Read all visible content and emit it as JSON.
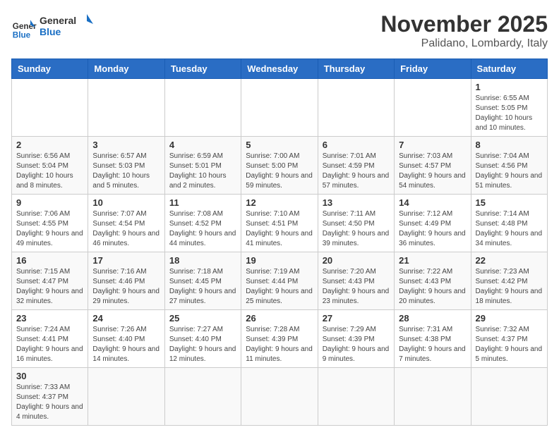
{
  "header": {
    "logo_general": "General",
    "logo_blue": "Blue",
    "month_title": "November 2025",
    "location": "Palidano, Lombardy, Italy"
  },
  "days_of_week": [
    "Sunday",
    "Monday",
    "Tuesday",
    "Wednesday",
    "Thursday",
    "Friday",
    "Saturday"
  ],
  "weeks": [
    [
      {
        "day": "",
        "info": ""
      },
      {
        "day": "",
        "info": ""
      },
      {
        "day": "",
        "info": ""
      },
      {
        "day": "",
        "info": ""
      },
      {
        "day": "",
        "info": ""
      },
      {
        "day": "",
        "info": ""
      },
      {
        "day": "1",
        "info": "Sunrise: 6:55 AM\nSunset: 5:05 PM\nDaylight: 10 hours and 10 minutes."
      }
    ],
    [
      {
        "day": "2",
        "info": "Sunrise: 6:56 AM\nSunset: 5:04 PM\nDaylight: 10 hours and 8 minutes."
      },
      {
        "day": "3",
        "info": "Sunrise: 6:57 AM\nSunset: 5:03 PM\nDaylight: 10 hours and 5 minutes."
      },
      {
        "day": "4",
        "info": "Sunrise: 6:59 AM\nSunset: 5:01 PM\nDaylight: 10 hours and 2 minutes."
      },
      {
        "day": "5",
        "info": "Sunrise: 7:00 AM\nSunset: 5:00 PM\nDaylight: 9 hours and 59 minutes."
      },
      {
        "day": "6",
        "info": "Sunrise: 7:01 AM\nSunset: 4:59 PM\nDaylight: 9 hours and 57 minutes."
      },
      {
        "day": "7",
        "info": "Sunrise: 7:03 AM\nSunset: 4:57 PM\nDaylight: 9 hours and 54 minutes."
      },
      {
        "day": "8",
        "info": "Sunrise: 7:04 AM\nSunset: 4:56 PM\nDaylight: 9 hours and 51 minutes."
      }
    ],
    [
      {
        "day": "9",
        "info": "Sunrise: 7:06 AM\nSunset: 4:55 PM\nDaylight: 9 hours and 49 minutes."
      },
      {
        "day": "10",
        "info": "Sunrise: 7:07 AM\nSunset: 4:54 PM\nDaylight: 9 hours and 46 minutes."
      },
      {
        "day": "11",
        "info": "Sunrise: 7:08 AM\nSunset: 4:52 PM\nDaylight: 9 hours and 44 minutes."
      },
      {
        "day": "12",
        "info": "Sunrise: 7:10 AM\nSunset: 4:51 PM\nDaylight: 9 hours and 41 minutes."
      },
      {
        "day": "13",
        "info": "Sunrise: 7:11 AM\nSunset: 4:50 PM\nDaylight: 9 hours and 39 minutes."
      },
      {
        "day": "14",
        "info": "Sunrise: 7:12 AM\nSunset: 4:49 PM\nDaylight: 9 hours and 36 minutes."
      },
      {
        "day": "15",
        "info": "Sunrise: 7:14 AM\nSunset: 4:48 PM\nDaylight: 9 hours and 34 minutes."
      }
    ],
    [
      {
        "day": "16",
        "info": "Sunrise: 7:15 AM\nSunset: 4:47 PM\nDaylight: 9 hours and 32 minutes."
      },
      {
        "day": "17",
        "info": "Sunrise: 7:16 AM\nSunset: 4:46 PM\nDaylight: 9 hours and 29 minutes."
      },
      {
        "day": "18",
        "info": "Sunrise: 7:18 AM\nSunset: 4:45 PM\nDaylight: 9 hours and 27 minutes."
      },
      {
        "day": "19",
        "info": "Sunrise: 7:19 AM\nSunset: 4:44 PM\nDaylight: 9 hours and 25 minutes."
      },
      {
        "day": "20",
        "info": "Sunrise: 7:20 AM\nSunset: 4:43 PM\nDaylight: 9 hours and 23 minutes."
      },
      {
        "day": "21",
        "info": "Sunrise: 7:22 AM\nSunset: 4:43 PM\nDaylight: 9 hours and 20 minutes."
      },
      {
        "day": "22",
        "info": "Sunrise: 7:23 AM\nSunset: 4:42 PM\nDaylight: 9 hours and 18 minutes."
      }
    ],
    [
      {
        "day": "23",
        "info": "Sunrise: 7:24 AM\nSunset: 4:41 PM\nDaylight: 9 hours and 16 minutes."
      },
      {
        "day": "24",
        "info": "Sunrise: 7:26 AM\nSunset: 4:40 PM\nDaylight: 9 hours and 14 minutes."
      },
      {
        "day": "25",
        "info": "Sunrise: 7:27 AM\nSunset: 4:40 PM\nDaylight: 9 hours and 12 minutes."
      },
      {
        "day": "26",
        "info": "Sunrise: 7:28 AM\nSunset: 4:39 PM\nDaylight: 9 hours and 11 minutes."
      },
      {
        "day": "27",
        "info": "Sunrise: 7:29 AM\nSunset: 4:39 PM\nDaylight: 9 hours and 9 minutes."
      },
      {
        "day": "28",
        "info": "Sunrise: 7:31 AM\nSunset: 4:38 PM\nDaylight: 9 hours and 7 minutes."
      },
      {
        "day": "29",
        "info": "Sunrise: 7:32 AM\nSunset: 4:37 PM\nDaylight: 9 hours and 5 minutes."
      }
    ],
    [
      {
        "day": "30",
        "info": "Sunrise: 7:33 AM\nSunset: 4:37 PM\nDaylight: 9 hours and 4 minutes."
      },
      {
        "day": "",
        "info": ""
      },
      {
        "day": "",
        "info": ""
      },
      {
        "day": "",
        "info": ""
      },
      {
        "day": "",
        "info": ""
      },
      {
        "day": "",
        "info": ""
      },
      {
        "day": "",
        "info": ""
      }
    ]
  ]
}
